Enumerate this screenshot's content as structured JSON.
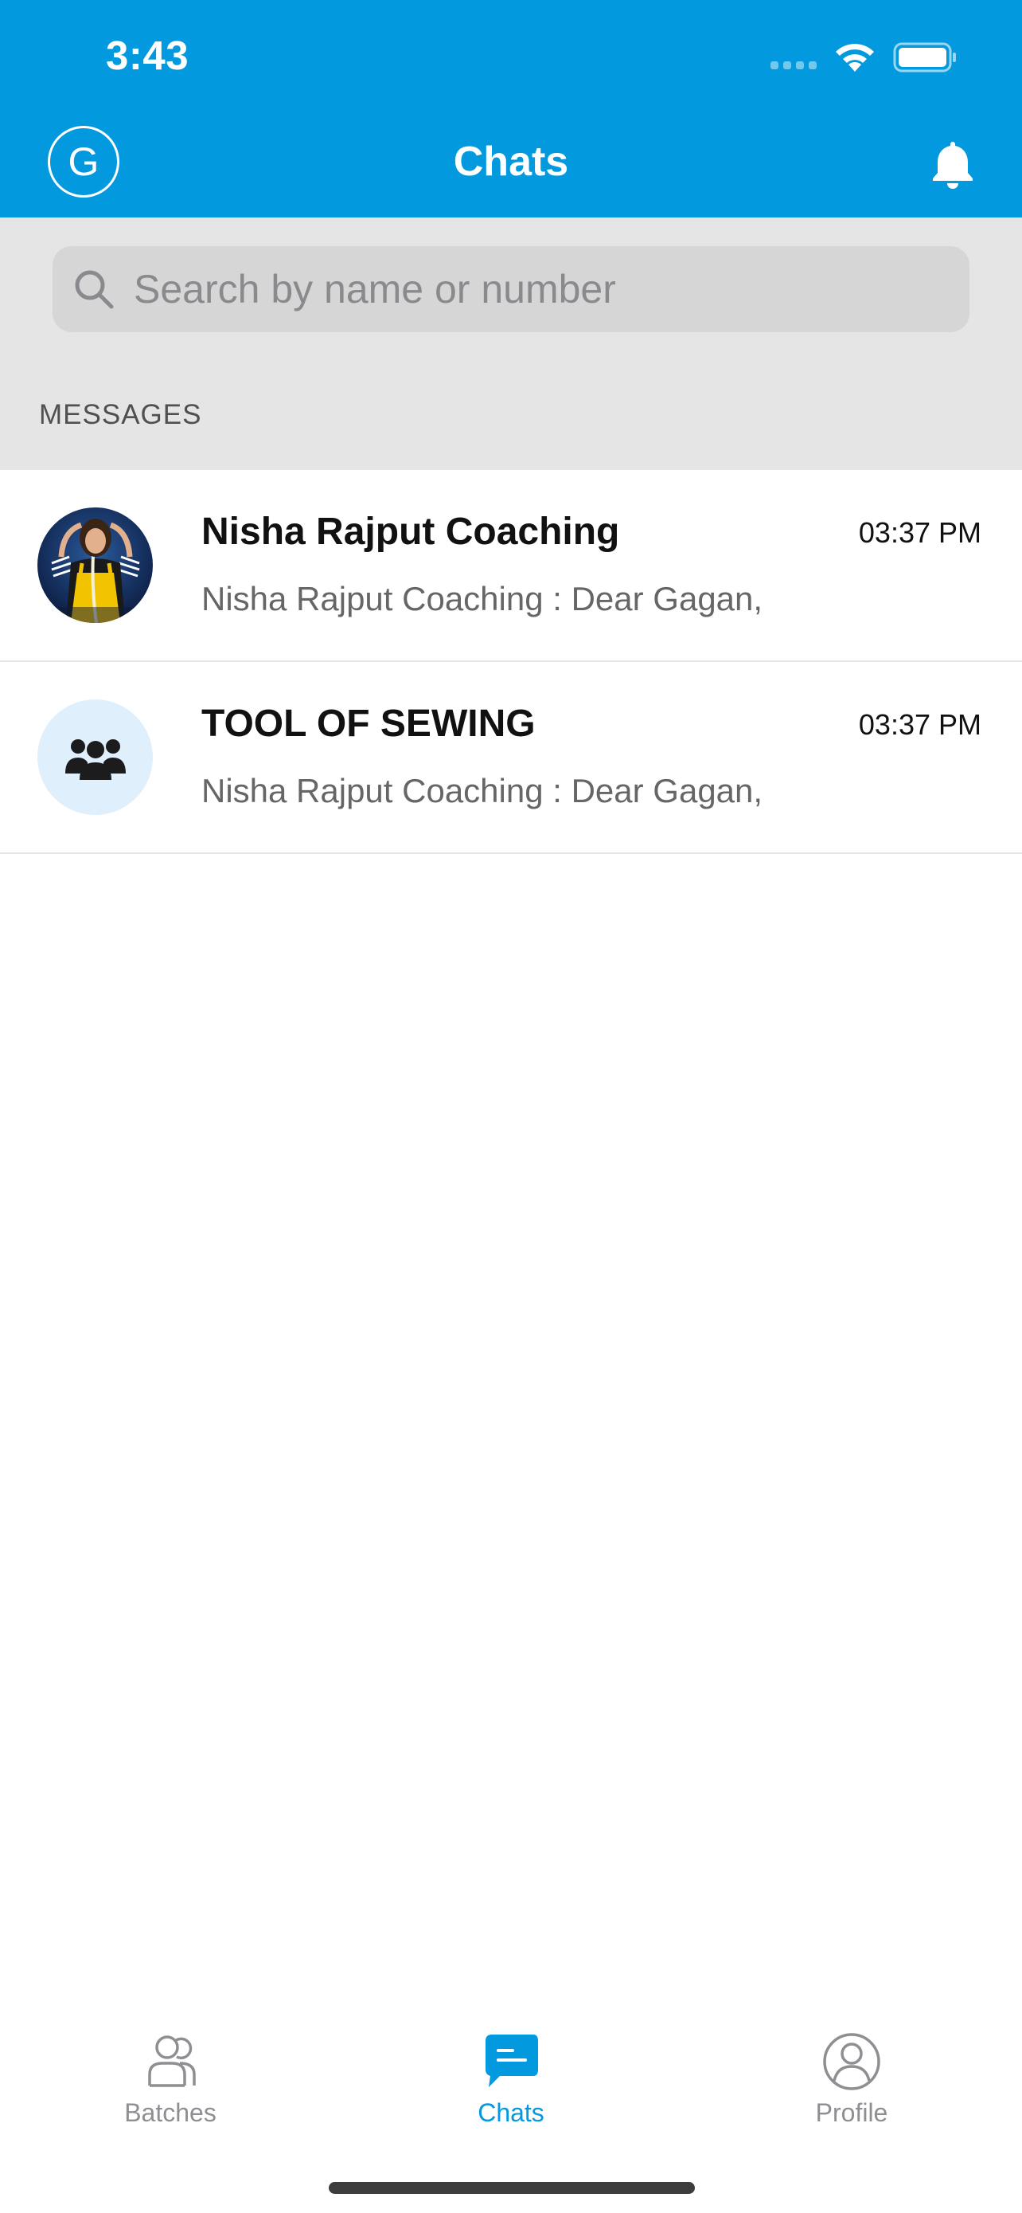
{
  "status_bar": {
    "time": "3:43"
  },
  "nav": {
    "avatar_initial": "G",
    "title": "Chats",
    "bell_icon": "bell-icon"
  },
  "search": {
    "placeholder": "Search by name or number"
  },
  "section_label": "MESSAGES",
  "chats": [
    {
      "name": "Nisha Rajput Coaching",
      "time": "03:37 PM",
      "preview": "Nisha Rajput Coaching  : Dear Gagan,",
      "avatar": "photo"
    },
    {
      "name": "TOOL OF SEWING",
      "time": "03:37 PM",
      "preview": "Nisha Rajput Coaching  : Dear Gagan,",
      "avatar": "group-icon"
    }
  ],
  "tabs": [
    {
      "label": "Batches",
      "icon": "batches-icon",
      "active": false
    },
    {
      "label": "Chats",
      "icon": "chat-bubble-icon",
      "active": true
    },
    {
      "label": "Profile",
      "icon": "profile-icon",
      "active": false
    }
  ],
  "colors": {
    "primary": "#0299de",
    "search_bg": "#e5e5e5",
    "search_field": "#d6d6d6",
    "tab_inactive": "#8e8e93",
    "group_avatar_bg": "#dfeffb"
  }
}
